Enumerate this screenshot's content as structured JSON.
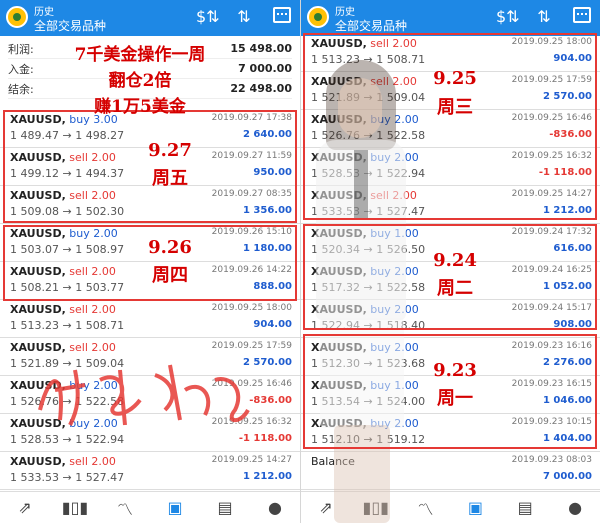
{
  "header": {
    "subtitle": "历史",
    "title": "全部交易品种"
  },
  "summary": [
    {
      "label": "利润:",
      "value": "15 498.00"
    },
    {
      "label": "入金:",
      "value": "7 000.00"
    },
    {
      "label": "结余:",
      "value": "22 498.00"
    }
  ],
  "annotations": {
    "headline1": "7千美金操作一周",
    "headline2": "翻仓2倍",
    "headline3": "赚1万5美金",
    "d927_date": "9.27",
    "d927_day": "周五",
    "d926_date": "9.26",
    "d926_day": "周四",
    "d925_date": "9.25",
    "d925_day": "周三",
    "d924_date": "9.24",
    "d924_day": "周二",
    "d923_date": "9.23",
    "d923_day": "周一"
  },
  "left_trades": [
    {
      "symbol": "XAUUSD,",
      "side": "buy 3.00",
      "type": "buy",
      "time": "2019.09.27 17:38",
      "prices": "1 489.47 → 1 498.27",
      "profit": "2 640.00",
      "sign": "pos"
    },
    {
      "symbol": "XAUUSD,",
      "side": "sell 2.00",
      "type": "sell",
      "time": "2019.09.27 11:59",
      "prices": "1 499.12 → 1 494.37",
      "profit": "950.00",
      "sign": "pos"
    },
    {
      "symbol": "XAUUSD,",
      "side": "sell 2.00",
      "type": "sell",
      "time": "2019.09.27 08:35",
      "prices": "1 509.08 → 1 502.30",
      "profit": "1 356.00",
      "sign": "pos"
    },
    {
      "symbol": "XAUUSD,",
      "side": "buy 2.00",
      "type": "buy",
      "time": "2019.09.26 15:10",
      "prices": "1 503.07 → 1 508.97",
      "profit": "1 180.00",
      "sign": "pos"
    },
    {
      "symbol": "XAUUSD,",
      "side": "sell 2.00",
      "type": "sell",
      "time": "2019.09.26 14:22",
      "prices": "1 508.21 → 1 503.77",
      "profit": "888.00",
      "sign": "pos"
    },
    {
      "symbol": "XAUUSD,",
      "side": "sell 2.00",
      "type": "sell",
      "time": "2019.09.25 18:00",
      "prices": "1 513.23 → 1 508.71",
      "profit": "904.00",
      "sign": "pos"
    },
    {
      "symbol": "XAUUSD,",
      "side": "sell 2.00",
      "type": "sell",
      "time": "2019.09.25 17:59",
      "prices": "1 521.89 → 1 509.04",
      "profit": "2 570.00",
      "sign": "pos"
    },
    {
      "symbol": "XAUUSD,",
      "side": "buy 2.00",
      "type": "buy",
      "time": "2019.09.25 16:46",
      "prices": "1 526.76 → 1 522.58",
      "profit": "-836.00",
      "sign": "neg"
    },
    {
      "symbol": "XAUUSD,",
      "side": "buy 2.00",
      "type": "buy",
      "time": "2019.09.25 16:32",
      "prices": "1 528.53 → 1 522.94",
      "profit": "-1 118.00",
      "sign": "neg"
    },
    {
      "symbol": "XAUUSD,",
      "side": "sell 2.00",
      "type": "sell",
      "time": "2019.09.25 14:27",
      "prices": "1 533.53 → 1 527.47",
      "profit": "1 212.00",
      "sign": "pos"
    }
  ],
  "right_trades": [
    {
      "symbol": "XAUUSD,",
      "side": "sell 2.00",
      "type": "sell",
      "time": "2019.09.25 18:00",
      "prices": "1 513.23 → 1 508.71",
      "profit": "904.00",
      "sign": "pos"
    },
    {
      "symbol": "XAUUSD,",
      "side": "sell 2.00",
      "type": "sell",
      "time": "2019.09.25 17:59",
      "prices": "1 521.89 → 1 509.04",
      "profit": "2 570.00",
      "sign": "pos"
    },
    {
      "symbol": "XAUUSD,",
      "side": "buy 2.00",
      "type": "buy",
      "time": "2019.09.25 16:46",
      "prices": "1 526.76 → 1 522.58",
      "profit": "-836.00",
      "sign": "neg"
    },
    {
      "symbol": "XAUUSD,",
      "side": "buy 2.00",
      "type": "buy",
      "time": "2019.09.25 16:32",
      "prices": "1 528.53 → 1 522.94",
      "profit": "-1 118.00",
      "sign": "neg"
    },
    {
      "symbol": "XAUUSD,",
      "side": "sell 2.00",
      "type": "sell",
      "time": "2019.09.25 14:27",
      "prices": "1 533.53 → 1 527.47",
      "profit": "1 212.00",
      "sign": "pos"
    },
    {
      "symbol": "XAUUSD,",
      "side": "buy 1.00",
      "type": "buy",
      "time": "2019.09.24 17:32",
      "prices": "1 520.34 → 1 526.50",
      "profit": "616.00",
      "sign": "pos"
    },
    {
      "symbol": "XAUUSD,",
      "side": "buy 2.00",
      "type": "buy",
      "time": "2019.09.24 16:25",
      "prices": "1 517.32 → 1 522.58",
      "profit": "1 052.00",
      "sign": "pos"
    },
    {
      "symbol": "XAUUSD,",
      "side": "buy 2.00",
      "type": "buy",
      "time": "2019.09.24 15:17",
      "prices": "1 522.94 → 1 518.40",
      "profit": "908.00",
      "sign": "pos"
    },
    {
      "symbol": "XAUUSD,",
      "side": "buy 2.00",
      "type": "buy",
      "time": "2019.09.23 16:16",
      "prices": "1 512.30 → 1 523.68",
      "profit": "2 276.00",
      "sign": "pos"
    },
    {
      "symbol": "XAUUSD,",
      "side": "buy 1.00",
      "type": "buy",
      "time": "2019.09.23 16:15",
      "prices": "1 513.54 → 1 524.00",
      "profit": "1 046.00",
      "sign": "pos"
    },
    {
      "symbol": "XAUUSD,",
      "side": "buy 2.00",
      "type": "buy",
      "time": "2019.09.23 10:15",
      "prices": "1 512.10 → 1 519.12",
      "profit": "1 404.00",
      "sign": "pos"
    }
  ],
  "balance": {
    "label": "Balance",
    "time": "2019.09.23 08:03",
    "value": "7 000.00"
  },
  "icons": {
    "currency": "dollar-exchange-icon",
    "sort": "sort-arrows-icon",
    "calendar": "calendar-icon",
    "nav": [
      "quotes-icon",
      "chart-icon",
      "trade-icon",
      "history-icon",
      "news-icon",
      "messages-icon"
    ]
  },
  "colors": {
    "header": "#1e88e5",
    "buy": "#1e5ccf",
    "sell": "#e53935",
    "annotation": "#d50000"
  }
}
